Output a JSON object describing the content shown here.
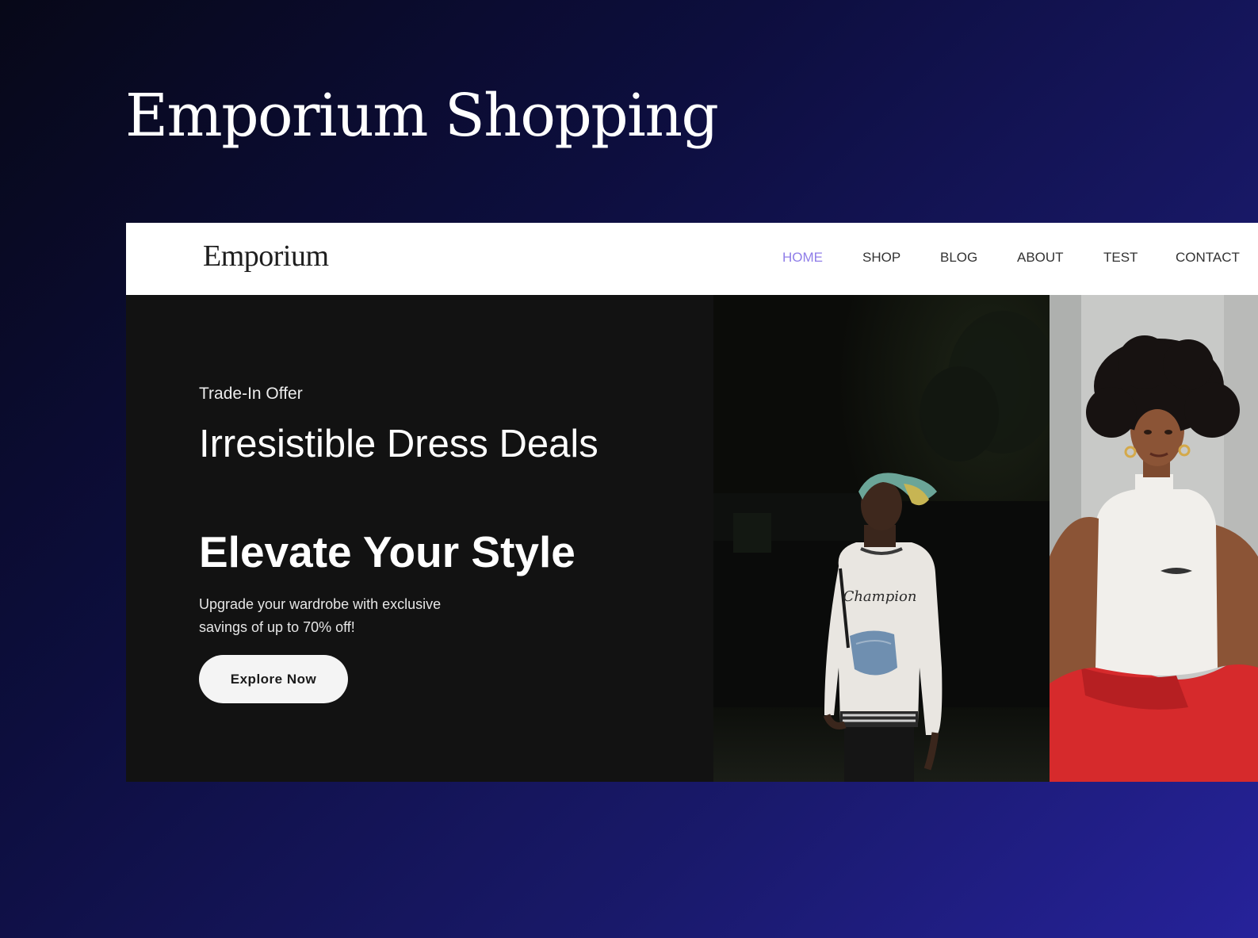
{
  "slide": {
    "title": "Emporium Shopping"
  },
  "site": {
    "logo": "Emporium",
    "nav": [
      {
        "label": "HOME",
        "active": true
      },
      {
        "label": "SHOP",
        "active": false
      },
      {
        "label": "BLOG",
        "active": false
      },
      {
        "label": "ABOUT",
        "active": false
      },
      {
        "label": "TEST",
        "active": false
      },
      {
        "label": "CONTACT",
        "active": false
      }
    ]
  },
  "hero": {
    "eyebrow": "Trade-In Offer",
    "headline": "Irresistible Dress Deals",
    "subheadline": "Elevate Your Style",
    "description": "Upgrade your wardrobe with exclusive savings of up to 70% off!",
    "cta_label": "Explore Now",
    "images": [
      {
        "icon": "photo-man-champion-sweatshirt-night",
        "shirt_text": "Champion"
      },
      {
        "icon": "photo-woman-white-top-red-trousers"
      }
    ]
  },
  "colors": {
    "nav_active": "#8f7ee8",
    "hero_background": "#121212",
    "cta_background": "#f4f4f4"
  }
}
